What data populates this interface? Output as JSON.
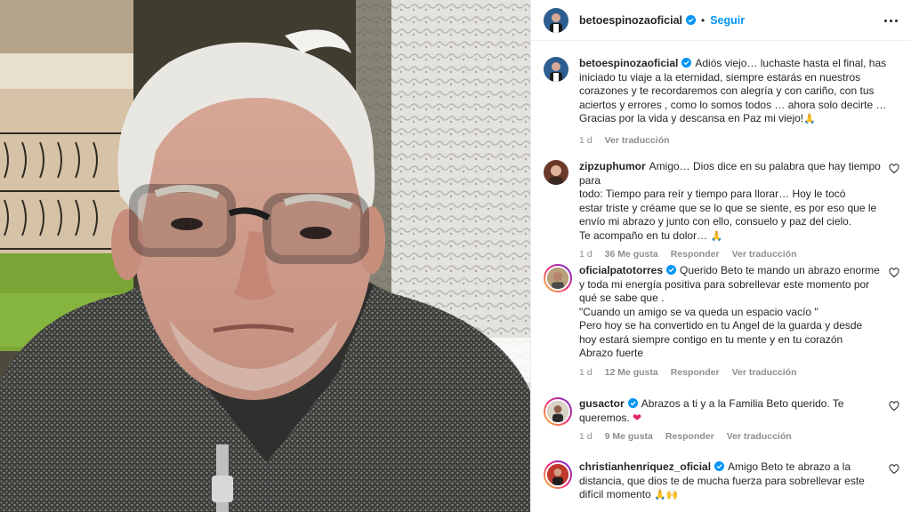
{
  "post": {
    "author": "betoespinozaoficial",
    "follow_label": "Seguir",
    "dot": "•"
  },
  "caption": {
    "user": "betoespinozaoficial",
    "lines": [
      "Adiós viejo… luchaste hasta el final, has",
      "iniciado tu viaje a la eternidad, siempre estarás en nuestros",
      "corazones y te recordaremos con alegría y con cariño, con tus",
      "aciertos y errores , como lo somos todos … ahora solo decirte …",
      "Gracias por la vida y descansa en Paz mi viejo!"
    ],
    "emoji": "🙏",
    "time": "1 d",
    "see_translation": "Ver traducción"
  },
  "comments": [
    {
      "user": "zipzuphumor",
      "verified": false,
      "lines": [
        "Amigo… Dios dice en su palabra que hay tiempo para",
        "todo: Tiempo para reír y tiempo para llorar… Hoy le tocó",
        "estar triste y créame que se lo que se siente, es por eso que le",
        "envío mi abrazo y junto con ello, consuelo y paz del cielo.",
        "Te acompaño en tu dolor…"
      ],
      "emoji": "🙏",
      "time": "1 d",
      "likes": "36 Me gusta",
      "reply": "Responder",
      "see_translation": "Ver traducción"
    },
    {
      "user": "oficialpatotorres",
      "verified": true,
      "lines": [
        "Querido Beto te mando un abrazo enorme",
        "y toda mi energía positiva para sobrellevar este momento por",
        "qué se sabe que .",
        "\"Cuando un amigo se va queda un espacio vacío \"",
        "Pero hoy se ha convertido en tu Angel de la guarda y desde",
        "hoy estará siempre contigo en tu mente y en tu corazón",
        "Abrazo fuerte"
      ],
      "emoji": "",
      "time": "1 d",
      "likes": "12 Me gusta",
      "reply": "Responder",
      "see_translation": "Ver traducción"
    },
    {
      "user": "gusactor",
      "verified": true,
      "lines": [
        "Abrazos a ti y a la Familia Beto querido. Te",
        "queremos."
      ],
      "emoji": "❤",
      "time": "1 d",
      "likes": "9 Me gusta",
      "reply": "Responder",
      "see_translation": "Ver traducción"
    },
    {
      "user": "christianhenriquez_oficial",
      "verified": true,
      "lines": [
        "Amigo Beto te abrazo a la",
        "distancia, que dios te de mucha fuerza para sobrellevar este",
        "difícil momento"
      ],
      "emoji": "🙏🙌",
      "time": "",
      "likes": "",
      "reply": "",
      "see_translation": ""
    }
  ],
  "colors": {
    "link_blue": "#0095f6",
    "verified_blue": "#0095f6",
    "meta_grey": "#8e8e8e",
    "text": "#262626",
    "heart_red": "#e0245e"
  },
  "icons": {
    "verified": "verified-badge-icon",
    "more": "more-options-icon",
    "like": "heart-outline-icon"
  }
}
